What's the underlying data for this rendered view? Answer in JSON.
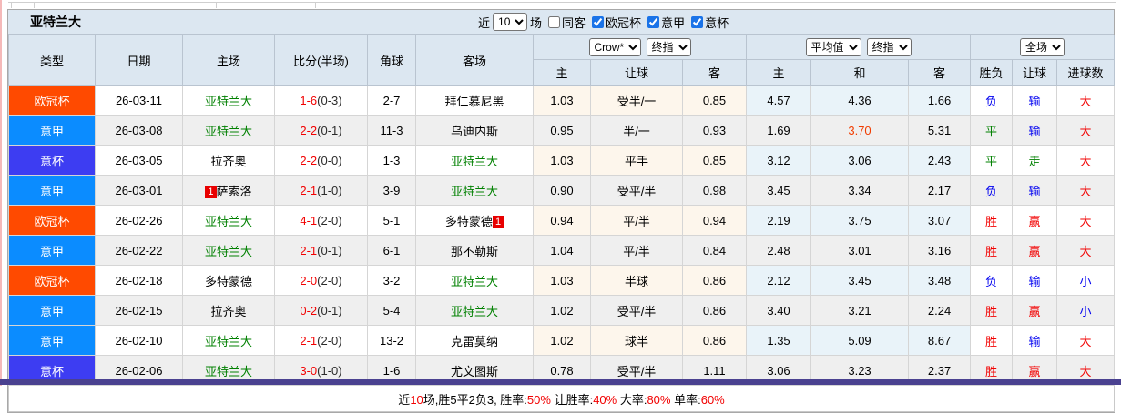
{
  "window": {
    "title_team": "亚特兰大"
  },
  "toolbar": {
    "near_label": "近",
    "near_value": "10",
    "matches_label": "场",
    "checkboxes": [
      {
        "label": "同客",
        "checked": false
      },
      {
        "label": "欧冠杯",
        "checked": true
      },
      {
        "label": "意甲",
        "checked": true
      },
      {
        "label": "意杯",
        "checked": true
      }
    ]
  },
  "table": {
    "col_headers": [
      "类型",
      "日期",
      "主场",
      "比分(半场)",
      "角球",
      "客场"
    ],
    "group_selects": {
      "book": "Crow*",
      "book_time": "终指",
      "avg": "平均值",
      "avg_time": "终指",
      "scope": "全场"
    },
    "sub_headers": [
      "主",
      "让球",
      "客",
      "主",
      "和",
      "客",
      "胜负",
      "让球",
      "进球数"
    ],
    "rows": [
      {
        "league": "欧冠杯",
        "date": "26-03-11",
        "home": {
          "name": "亚特兰大",
          "green": true,
          "card": ""
        },
        "score": "1-6",
        "half": "(0-3)",
        "corner": "2-7",
        "away": {
          "name": "拜仁慕尼黑",
          "green": false,
          "card": ""
        },
        "odds": [
          "1.03",
          "受半/一",
          "0.85"
        ],
        "avg": [
          "4.57",
          "4.36",
          "1.66"
        ],
        "avg_changed": -1,
        "results": [
          [
            "负",
            "b"
          ],
          [
            "输",
            "b"
          ],
          [
            "大",
            "r"
          ]
        ]
      },
      {
        "league": "意甲",
        "date": "26-03-08",
        "home": {
          "name": "亚特兰大",
          "green": true,
          "card": ""
        },
        "score": "2-2",
        "half": "(0-1)",
        "corner": "11-3",
        "away": {
          "name": "乌迪内斯",
          "green": false,
          "card": ""
        },
        "odds": [
          "0.95",
          "半/一",
          "0.93"
        ],
        "avg": [
          "1.69",
          "3.70",
          "5.31"
        ],
        "avg_changed": 1,
        "results": [
          [
            "平",
            "g"
          ],
          [
            "输",
            "b"
          ],
          [
            "大",
            "r"
          ]
        ]
      },
      {
        "league": "意杯",
        "date": "26-03-05",
        "home": {
          "name": "拉齐奥",
          "green": false,
          "card": ""
        },
        "score": "2-2",
        "half": "(0-0)",
        "corner": "1-3",
        "away": {
          "name": "亚特兰大",
          "green": true,
          "card": ""
        },
        "odds": [
          "1.03",
          "平手",
          "0.85"
        ],
        "avg": [
          "3.12",
          "3.06",
          "2.43"
        ],
        "avg_changed": -1,
        "results": [
          [
            "平",
            "g"
          ],
          [
            "走",
            "g"
          ],
          [
            "大",
            "r"
          ]
        ]
      },
      {
        "league": "意甲",
        "date": "26-03-01",
        "home": {
          "name": "萨索洛",
          "green": false,
          "card": "1"
        },
        "score": "2-1",
        "half": "(1-0)",
        "corner": "3-9",
        "away": {
          "name": "亚特兰大",
          "green": true,
          "card": ""
        },
        "odds": [
          "0.90",
          "受平/半",
          "0.98"
        ],
        "avg": [
          "3.45",
          "3.34",
          "2.17"
        ],
        "avg_changed": -1,
        "results": [
          [
            "负",
            "b"
          ],
          [
            "输",
            "b"
          ],
          [
            "大",
            "r"
          ]
        ]
      },
      {
        "league": "欧冠杯",
        "date": "26-02-26",
        "home": {
          "name": "亚特兰大",
          "green": true,
          "card": ""
        },
        "score": "4-1",
        "half": "(2-0)",
        "corner": "5-1",
        "away": {
          "name": "多特蒙德",
          "green": false,
          "card": "1"
        },
        "odds": [
          "0.94",
          "平/半",
          "0.94"
        ],
        "avg": [
          "2.19",
          "3.75",
          "3.07"
        ],
        "avg_changed": -1,
        "results": [
          [
            "胜",
            "r"
          ],
          [
            "赢",
            "r"
          ],
          [
            "大",
            "r"
          ]
        ]
      },
      {
        "league": "意甲",
        "date": "26-02-22",
        "home": {
          "name": "亚特兰大",
          "green": true,
          "card": ""
        },
        "score": "2-1",
        "half": "(0-1)",
        "corner": "6-1",
        "away": {
          "name": "那不勒斯",
          "green": false,
          "card": ""
        },
        "odds": [
          "1.04",
          "平/半",
          "0.84"
        ],
        "avg": [
          "2.48",
          "3.01",
          "3.16"
        ],
        "avg_changed": -1,
        "results": [
          [
            "胜",
            "r"
          ],
          [
            "赢",
            "r"
          ],
          [
            "大",
            "r"
          ]
        ]
      },
      {
        "league": "欧冠杯",
        "date": "26-02-18",
        "home": {
          "name": "多特蒙德",
          "green": false,
          "card": ""
        },
        "score": "2-0",
        "half": "(2-0)",
        "corner": "3-2",
        "away": {
          "name": "亚特兰大",
          "green": true,
          "card": ""
        },
        "odds": [
          "1.03",
          "半球",
          "0.86"
        ],
        "avg": [
          "2.12",
          "3.45",
          "3.48"
        ],
        "avg_changed": -1,
        "results": [
          [
            "负",
            "b"
          ],
          [
            "输",
            "b"
          ],
          [
            "小",
            "b"
          ]
        ]
      },
      {
        "league": "意甲",
        "date": "26-02-15",
        "home": {
          "name": "拉齐奥",
          "green": false,
          "card": ""
        },
        "score": "0-2",
        "half": "(0-1)",
        "corner": "5-4",
        "away": {
          "name": "亚特兰大",
          "green": true,
          "card": ""
        },
        "odds": [
          "1.02",
          "受平/半",
          "0.86"
        ],
        "avg": [
          "3.40",
          "3.21",
          "2.24"
        ],
        "avg_changed": -1,
        "results": [
          [
            "胜",
            "r"
          ],
          [
            "赢",
            "r"
          ],
          [
            "小",
            "b"
          ]
        ]
      },
      {
        "league": "意甲",
        "date": "26-02-10",
        "home": {
          "name": "亚特兰大",
          "green": true,
          "card": ""
        },
        "score": "2-1",
        "half": "(2-0)",
        "corner": "13-2",
        "away": {
          "name": "克雷莫纳",
          "green": false,
          "card": ""
        },
        "odds": [
          "1.02",
          "球半",
          "0.86"
        ],
        "avg": [
          "1.35",
          "5.09",
          "8.67"
        ],
        "avg_changed": -1,
        "results": [
          [
            "胜",
            "r"
          ],
          [
            "输",
            "b"
          ],
          [
            "大",
            "r"
          ]
        ]
      },
      {
        "league": "意杯",
        "date": "26-02-06",
        "home": {
          "name": "亚特兰大",
          "green": true,
          "card": ""
        },
        "score": "3-0",
        "half": "(1-0)",
        "corner": "1-6",
        "away": {
          "name": "尤文图斯",
          "green": false,
          "card": ""
        },
        "odds": [
          "0.78",
          "受平/半",
          "1.11"
        ],
        "avg": [
          "3.06",
          "3.23",
          "2.37"
        ],
        "avg_changed": -1,
        "results": [
          [
            "胜",
            "r"
          ],
          [
            "赢",
            "r"
          ],
          [
            "大",
            "r"
          ]
        ]
      }
    ]
  },
  "summary": {
    "segments": [
      {
        "t": "近",
        "c": "k"
      },
      {
        "t": "10",
        "c": "r"
      },
      {
        "t": "场,胜5平2负3, 胜率:",
        "c": "k"
      },
      {
        "t": "50%",
        "c": "r"
      },
      {
        "t": " 让胜率:",
        "c": "k"
      },
      {
        "t": "40%",
        "c": "r"
      },
      {
        "t": " 大率:",
        "c": "k"
      },
      {
        "t": "80%",
        "c": "r"
      },
      {
        "t": " 单率:",
        "c": "k"
      },
      {
        "t": "60%",
        "c": "r"
      }
    ]
  },
  "colors": {
    "red": "#f20000",
    "green": "#008000",
    "blue": "#0000f0",
    "league": {
      "欧冠杯": "#ff4a00",
      "意甲": "#0b8cff",
      "意杯": "#3d3df2"
    },
    "bottom_bar": "#4a4190"
  }
}
